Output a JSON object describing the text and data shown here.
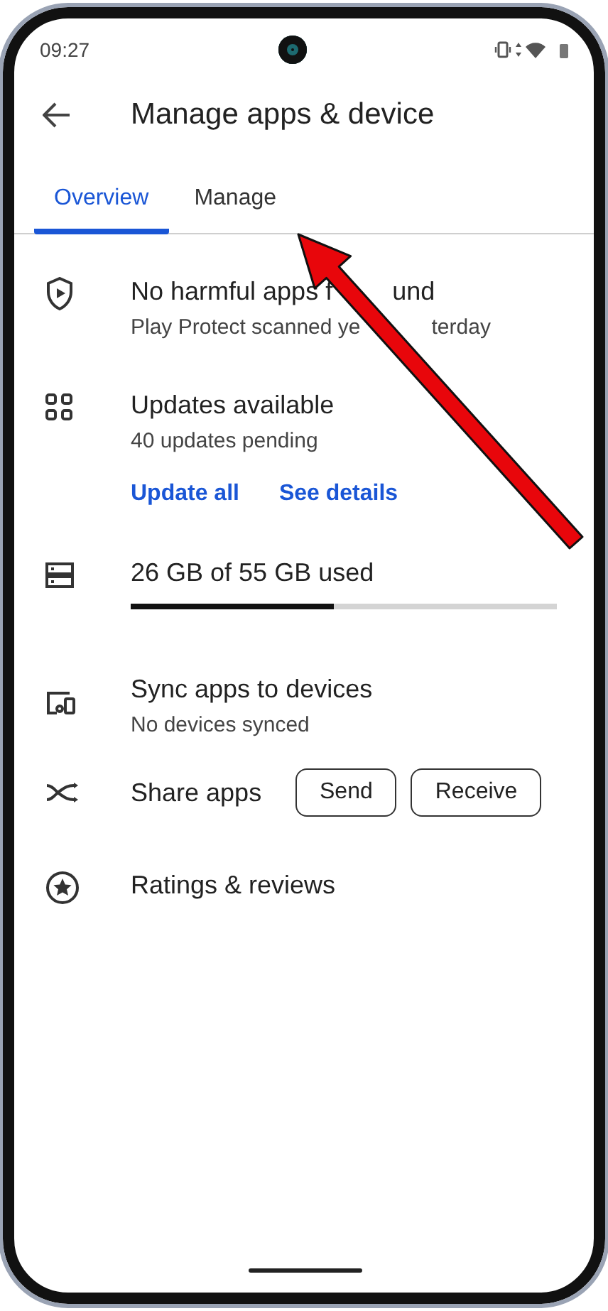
{
  "status_bar": {
    "time": "09:27"
  },
  "header": {
    "title": "Manage apps & device"
  },
  "tabs": [
    {
      "label": "Overview",
      "selected": true
    },
    {
      "label": "Manage",
      "selected": false
    }
  ],
  "items": [
    {
      "kind": "protect",
      "title_parts": [
        "No harmful apps f",
        "und"
      ],
      "subtitle_parts": [
        "Play Protect scanned ye",
        "terday"
      ]
    },
    {
      "kind": "updates",
      "title": "Updates available",
      "subtitle": "40 updates pending",
      "actions": [
        "Update all",
        "See details"
      ]
    },
    {
      "kind": "storage",
      "title": "26 GB of 55 GB used",
      "level": 0.475
    },
    {
      "kind": "sync",
      "title": "Sync apps to devices",
      "subtitle": "No devices synced"
    },
    {
      "kind": "share",
      "title": "Share apps",
      "buttons": [
        "Send",
        "Receive"
      ]
    },
    {
      "kind": "ratings",
      "title": "Ratings & reviews"
    }
  ]
}
